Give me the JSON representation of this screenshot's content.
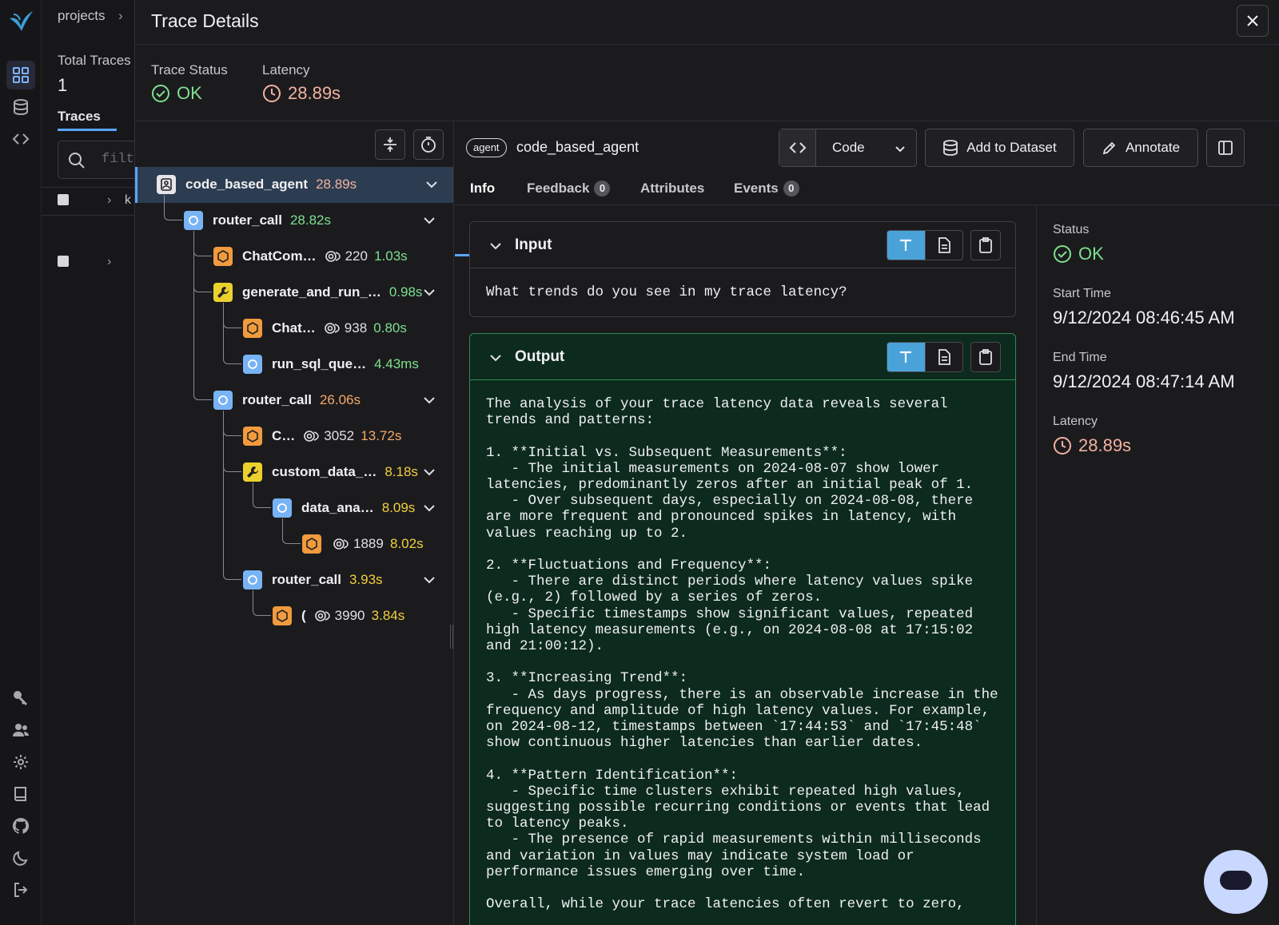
{
  "colors": {
    "accent": "#5aa4ff",
    "ok": "#7ee08e",
    "latency": "#f3b2a0",
    "output_bg": "#0c2a1d"
  },
  "background": {
    "breadcrumb": "projects",
    "total_traces_label": "Total Traces",
    "total_traces_value": "1",
    "traces_tab": "Traces",
    "filter_placeholder": "filt",
    "row_char": "k"
  },
  "rail": {
    "icons": [
      "arize-logo-icon",
      "grid-icon",
      "database-icon",
      "code-icon",
      "key-icon",
      "users-icon",
      "gear-icon",
      "book-icon",
      "github-icon",
      "moon-icon",
      "logout-icon"
    ]
  },
  "panel": {
    "title": "Trace Details",
    "trace_status_label": "Trace Status",
    "trace_status_value": "OK",
    "latency_label": "Latency",
    "latency_value": "28.89s"
  },
  "tree": [
    {
      "name": "code_based_agent",
      "latency": "28.89s",
      "kind": "agent",
      "depth": 0,
      "expanded": true
    },
    {
      "name": "router_call",
      "latency": "28.82s",
      "kind": "chain",
      "depth": 1,
      "expanded": true
    },
    {
      "name": "ChatCom…",
      "tokens": "220",
      "latency": "1.03s",
      "kind": "llm",
      "depth": 2
    },
    {
      "name": "generate_and_run_…",
      "latency": "0.98s",
      "kind": "tool",
      "depth": 2,
      "expanded": true
    },
    {
      "name": "Chat…",
      "tokens": "938",
      "latency": "0.80s",
      "kind": "llm",
      "depth": 3
    },
    {
      "name": "run_sql_que…",
      "latency": "4.43ms",
      "kind": "chain",
      "depth": 3
    },
    {
      "name": "router_call",
      "latency": "26.06s",
      "kind": "chain",
      "depth": 2,
      "expanded": true
    },
    {
      "name": "C…",
      "tokens": "3052",
      "latency": "13.72s",
      "kind": "llm",
      "depth": 3
    },
    {
      "name": "custom_data_…",
      "latency": "8.18s",
      "kind": "tool",
      "depth": 3,
      "expanded": true
    },
    {
      "name": "data_ana…",
      "latency": "8.09s",
      "kind": "chain",
      "depth": 4,
      "expanded": true
    },
    {
      "name": "",
      "tokens": "1889",
      "latency": "8.02s",
      "kind": "llm",
      "depth": 5
    },
    {
      "name": "router_call",
      "latency": "3.93s",
      "kind": "chain",
      "depth": 3,
      "expanded": true
    },
    {
      "name": "(",
      "tokens": "3990",
      "latency": "3.84s",
      "kind": "llm",
      "depth": 4
    }
  ],
  "detail": {
    "badge": "agent",
    "span_name": "code_based_agent",
    "view_select": "Code",
    "add_dataset": "Add to Dataset",
    "annotate": "Annotate",
    "tabs": {
      "info": "Info",
      "feedback": "Feedback",
      "feedback_count": "0",
      "attributes": "Attributes",
      "events": "Events",
      "events_count": "0"
    },
    "input_title": "Input",
    "input_text": "What trends do you see in my trace latency?",
    "output_title": "Output",
    "output_text": "The analysis of your trace latency data reveals several\ntrends and patterns:\n\n1. **Initial vs. Subsequent Measurements**:\n   - The initial measurements on 2024-08-07 show lower\nlatencies, predominantly zeros after an initial peak of 1.\n   - Over subsequent days, especially on 2024-08-08, there\nare more frequent and pronounced spikes in latency, with\nvalues reaching up to 2.\n\n2. **Fluctuations and Frequency**:\n   - There are distinct periods where latency values spike\n(e.g., 2) followed by a series of zeros.\n   - Specific timestamps show significant values, repeated\nhigh latency measurements (e.g., on 2024-08-08 at 17:15:02\nand 21:00:12).\n\n3. **Increasing Trend**:\n   - As days progress, there is an observable increase in the\nfrequency and amplitude of high latency values. For example,\non 2024-08-12, timestamps between `17:44:53` and `17:45:48`\nshow continuous higher latencies than earlier dates.\n\n4. **Pattern Identification**:\n   - Specific time clusters exhibit repeated high values,\nsuggesting possible recurring conditions or events that lead\nto latency peaks.\n   - The presence of rapid measurements within milliseconds\nand variation in values may indicate system load or\nperformance issues emerging over time.\n\nOverall, while your trace latencies often revert to zero,",
    "side": {
      "status_label": "Status",
      "status_value": "OK",
      "start_label": "Start Time",
      "start_value": "9/12/2024 08:46:45 AM",
      "end_label": "End Time",
      "end_value": "9/12/2024 08:47:14 AM",
      "latency_label": "Latency",
      "latency_value": "28.89s"
    }
  }
}
